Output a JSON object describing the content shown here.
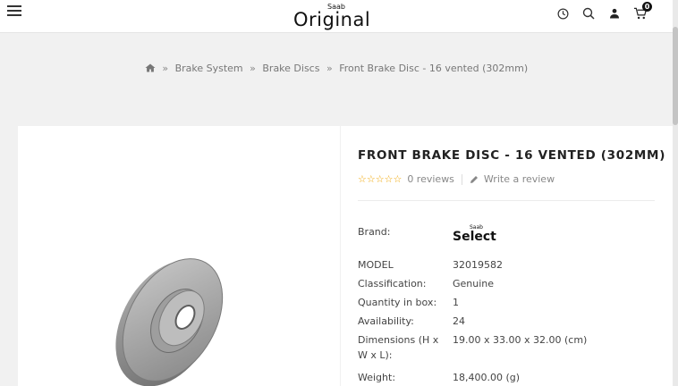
{
  "header": {
    "logo_main": "Original",
    "logo_small": "Saab",
    "cart_count": "0"
  },
  "breadcrumb": {
    "items": [
      "Brake System",
      "Brake Discs",
      "Front Brake Disc - 16 vented (302mm)"
    ]
  },
  "product": {
    "title": "FRONT BRAKE DISC - 16 VENTED (302MM)",
    "stars": "☆☆☆☆☆",
    "reviews_label": "0 reviews",
    "write_review_label": "Write a review",
    "brand_label": "Brand:",
    "brand_logo_main": "Select",
    "brand_logo_small": "Saab",
    "specs": [
      {
        "label": "MODEL",
        "value": "32019582"
      },
      {
        "label": "Classification:",
        "value": "Genuine"
      },
      {
        "label": "Quantity in box:",
        "value": "1"
      },
      {
        "label": "Availability:",
        "value": "24"
      },
      {
        "label": "Dimensions (H x W x L):",
        "value": "19.00 x 33.00 x 32.00 (cm)"
      },
      {
        "label": "Weight:",
        "value": "18,400.00 (g)"
      }
    ]
  },
  "icons": {
    "menu": "hamburger-icon",
    "history": "clock-icon",
    "search": "search-icon",
    "account": "user-icon",
    "cart": "cart-icon",
    "home": "home-icon",
    "pencil": "pencil-icon"
  },
  "colors": {
    "star": "#f0a500",
    "page_bg": "#f1f1f1",
    "panel_bg": "#ffffff"
  }
}
